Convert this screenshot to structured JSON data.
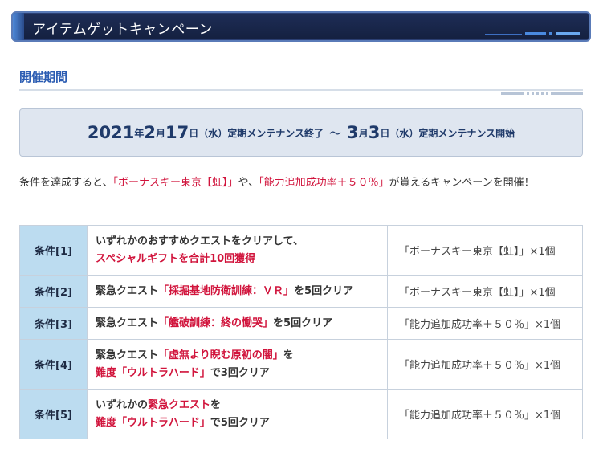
{
  "banner": {
    "title": "アイテムゲットキャンペーン"
  },
  "section": {
    "heading": "開催期間"
  },
  "period": {
    "start_year": "2021",
    "year_suffix": "年",
    "start_month": "2",
    "month_suffix": "月",
    "start_day": "17",
    "day_suffix": "日",
    "start_weekday": "（水）",
    "start_event": "定期メンテナンス終了",
    "tilde": "～",
    "end_month": "3",
    "end_day": "3",
    "end_weekday": "（水）",
    "end_event": "定期メンテナンス開始"
  },
  "intro": {
    "part1": "条件を達成すると、",
    "item1": "「ボーナスキー東京【虹】」",
    "part2": "や、",
    "item2": "「能力追加成功率＋５０％」",
    "part3": "が貰えるキャンペーンを開催！"
  },
  "conditions": [
    {
      "label": "条件[1]",
      "desc_line1": "いずれかのおすすめクエストをクリアして、",
      "desc_red": "スペシャルギフトを合計10回獲得",
      "reward": "「ボーナスキー東京【虹】」×1個"
    },
    {
      "label": "条件[2]",
      "desc_pre": "緊急クエスト",
      "desc_red": "「採掘基地防衛訓練：ＶＲ」",
      "desc_post": "を5回クリア",
      "reward": "「ボーナスキー東京【虹】」×1個"
    },
    {
      "label": "条件[3]",
      "desc_pre": "緊急クエスト",
      "desc_red": "「艦破訓練：終の慟哭」",
      "desc_post": "を5回クリア",
      "reward": "「能力追加成功率＋５０％」×1個"
    },
    {
      "label": "条件[4]",
      "desc_pre": "緊急クエスト",
      "desc_red": "「虚無より睨む原初の闇」",
      "desc_post": "を",
      "desc_red2": "難度「ウルトラハード」",
      "desc_post2": "で3回クリア",
      "reward": "「能力追加成功率＋５０％」×1個"
    },
    {
      "label": "条件[5]",
      "desc_pre": "いずれかの",
      "desc_red": "緊急クエスト",
      "desc_post": "を",
      "desc_red2": "難度「ウルトラハード」",
      "desc_post2": "で5回クリア",
      "reward": "「能力追加成功率＋５０％」×1個"
    }
  ],
  "colors": {
    "banner_bg": "#1e2d57",
    "banner_border": "#5a7bb8",
    "heading": "#2b5cb2",
    "period_bg": "#dfe6f0",
    "period_text": "#1f3a6a",
    "highlight_red": "#d1143c",
    "label_cell_bg": "#bcdcf0"
  }
}
